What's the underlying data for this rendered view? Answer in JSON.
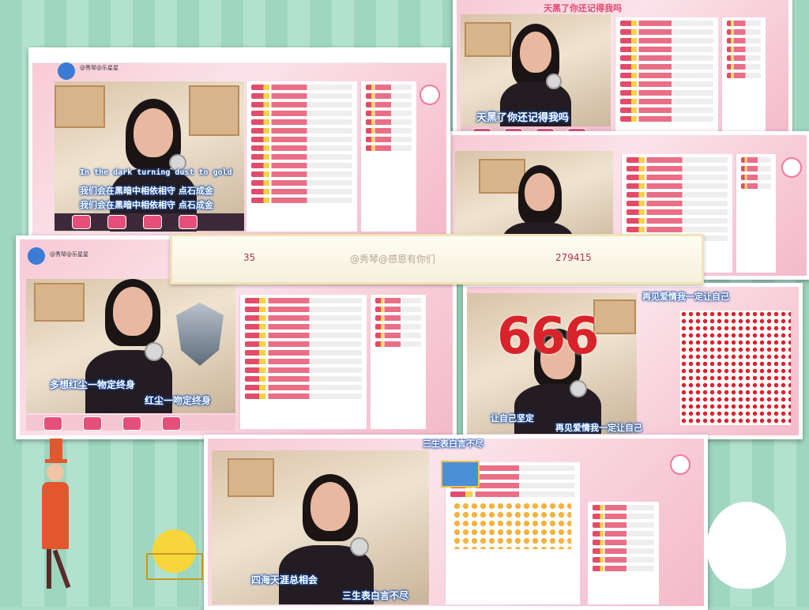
{
  "screens": {
    "s1": {
      "streamer": "@秀琴@乐星星",
      "lyric1": "In the dark turning dust to gold",
      "lyric2": "我们会在黑暗中相依相守 点石成金",
      "lyric3": "我们会在黑暗中相依相守 点石成金"
    },
    "s2": {
      "title": "天黑了你还记得我吗",
      "caption": "天黑了你还记得我吗"
    },
    "s4": {
      "streamer": "@秀琴@乐星星",
      "lyric1": "多想红尘一物定终身",
      "lyric2": "红尘一吻定终身"
    },
    "s5": {
      "top": "再见爱情我一定让自己",
      "big": "666",
      "left": "让自己坚定",
      "bottom": "再见爱情我一定让自己"
    },
    "s6": {
      "title": "三生表白言不尽",
      "lyric1": "四海天涯总相会",
      "lyric2": "三生表白言不尽"
    }
  },
  "banner": {
    "left_number": "35",
    "name": "@秀琴@感恩有你们",
    "right_number": "279415"
  },
  "colors": {
    "background": "#a9dcc8",
    "accent": "#e8456f",
    "lyric_glow": "#1a5fd0"
  }
}
